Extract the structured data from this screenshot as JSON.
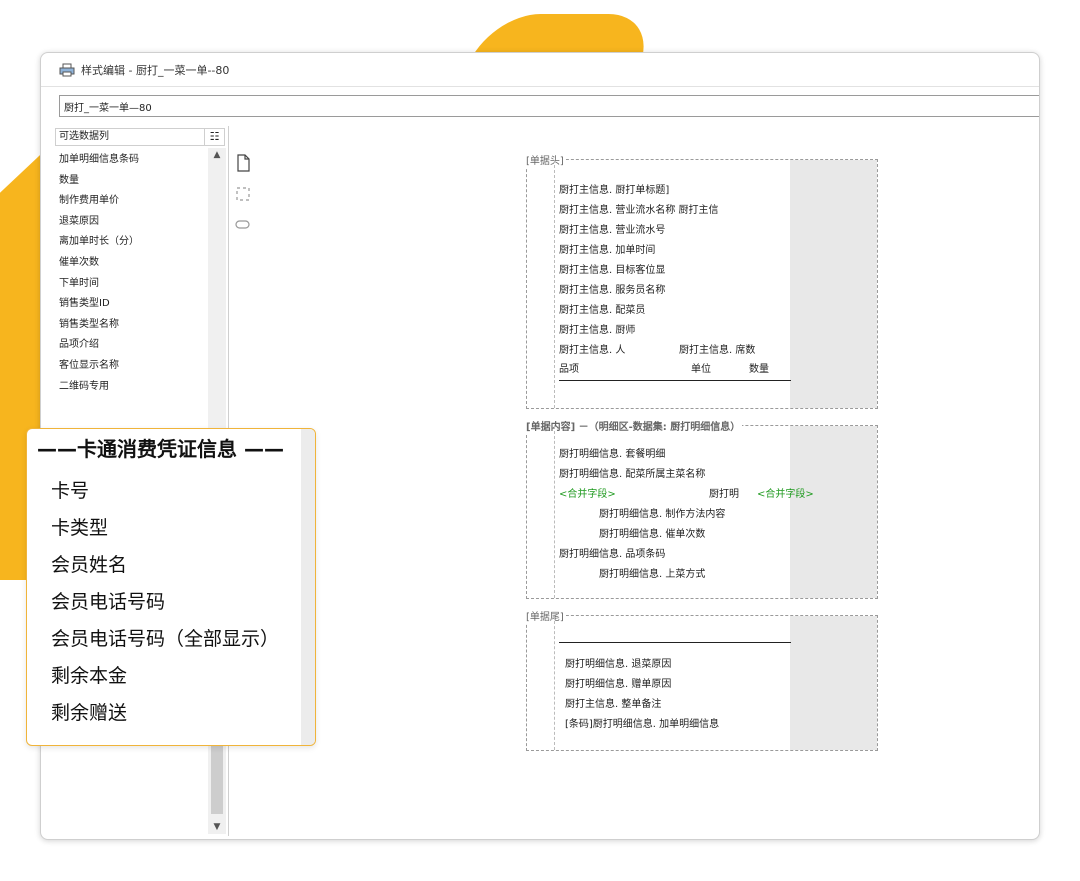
{
  "window": {
    "title": "样式编辑 - 厨打_一菜一单--80",
    "name_field_value": "厨打_一菜一单—80"
  },
  "left_panel": {
    "header": "可选数据列",
    "list_button": "☷",
    "items": [
      "加单明细信息条码",
      "数量",
      "制作费用单价",
      "退菜原因",
      "离加单时长（分）",
      "催单次数",
      "下单时间",
      "销售类型ID",
      "销售类型名称",
      "品项介绍",
      "客位显示名称",
      "二维码专用"
    ]
  },
  "card_panel": {
    "header": "——卡通消费凭证信息 ——",
    "items": [
      "卡号",
      "卡类型",
      "会员姓名",
      "会员电话号码",
      "会员电话号码（全部显示）",
      "剩余本金",
      "剩余赠送"
    ]
  },
  "sections": {
    "header": {
      "tag": "[单据头]",
      "lines": [
        "厨打主信息. 厨打单标题]",
        "厨打主信息. 营业流水名称 厨打主信",
        "厨打主信息. 营业流水号",
        "厨打主信息. 加单时间",
        "厨打主信息. 目标客位显",
        "厨打主信息. 服务员名称",
        "厨打主信息. 配菜员",
        "厨打主信息. 厨师",
        "厨打主信息. 人"
      ],
      "seat_field": "厨打主信息. 席数",
      "col_item": "品项",
      "col_unit": "单位",
      "col_qty": "数量"
    },
    "content": {
      "tag": "[单据内容] －（明细区-数据集: 厨打明细信息）",
      "lines": [
        "厨打明细信息. 套餐明细",
        "厨打明细信息. 配菜所属主菜名称"
      ],
      "merge_left": "<合并字段>",
      "merge_mid": "厨打明",
      "merge_right": "<合并字段>",
      "indented": [
        "厨打明细信息. 制作方法内容",
        "厨打明细信息. 催单次数"
      ],
      "barcode_line": "厨打明细信息. 品项条码",
      "serve_line": "厨打明细信息. 上菜方式"
    },
    "footer": {
      "tag": "[单据尾]",
      "lines": [
        "厨打明细信息. 退菜原因",
        "厨打明细信息. 赠单原因",
        "厨打主信息. 整单备注",
        "[条码]厨打明细信息. 加单明细信息"
      ]
    }
  },
  "colors": {
    "accent": "#f7b51e",
    "merge_field": "#1f9a1f",
    "section_gray": "#e8e8e8"
  },
  "icons": [
    "printer-icon",
    "list-view-icon",
    "new-page-icon",
    "select-frame-icon",
    "shape-icon",
    "scroll-up-icon",
    "scroll-down-icon"
  ]
}
